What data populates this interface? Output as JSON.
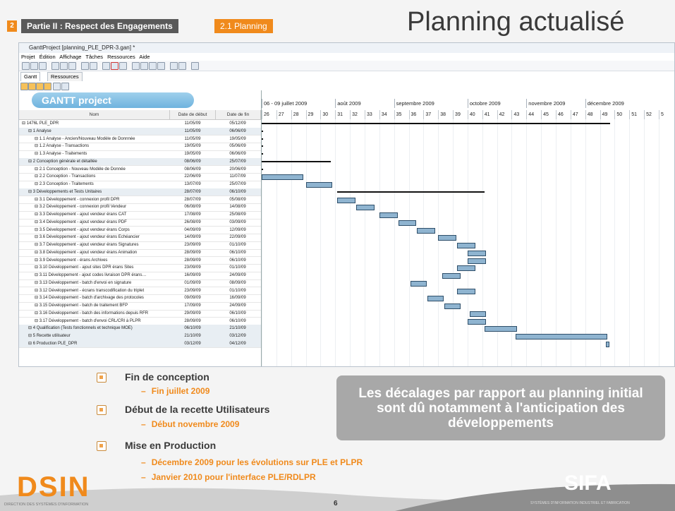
{
  "header": {
    "section_number": "2",
    "section_title": "Partie II : Respect des Engagements",
    "subsection": "2.1 Planning",
    "slide_title": "Planning actualisé"
  },
  "app": {
    "window_title": "GanttProject [planning_PLE_DPR-3.gan] *",
    "menu": [
      "Projet",
      "Édition",
      "Affichage",
      "Tâches",
      "Ressources",
      "Aide"
    ],
    "tabs": [
      "Gantt",
      "Ressources"
    ],
    "logo_text": "GANTT project",
    "columns": [
      "Nom",
      "Date de début",
      "Date de fin"
    ],
    "months": [
      "06 - 09 juillet 2009",
      "août 2009",
      "septembre 2009",
      "octobre 2009",
      "novembre 2009",
      "décembre 2009"
    ],
    "weeks": [
      "26",
      "27",
      "28",
      "29",
      "30",
      "31",
      "32",
      "33",
      "34",
      "35",
      "36",
      "37",
      "38",
      "39",
      "40",
      "41",
      "42",
      "43",
      "44",
      "45",
      "46",
      "47",
      "48",
      "49",
      "50",
      "51",
      "52",
      "5"
    ],
    "tasks": [
      {
        "name": "1476L PLE_DPR",
        "start": "11/05/09",
        "end": "05/12/09",
        "indent": 0
      },
      {
        "name": "1 Analyse",
        "start": "11/05/09",
        "end": "06/06/09",
        "indent": 1
      },
      {
        "name": "1.1 Analyse - Ancien/Nouveau Modèle de Donnnée",
        "start": "11/05/09",
        "end": "19/05/09",
        "indent": 2
      },
      {
        "name": "1.2 Analyse - Transactions",
        "start": "19/05/09",
        "end": "05/06/09",
        "indent": 2
      },
      {
        "name": "1.3 Analyse - Traitements",
        "start": "19/05/09",
        "end": "06/06/09",
        "indent": 2
      },
      {
        "name": "2 Conception générale et détaillée",
        "start": "08/06/09",
        "end": "25/07/09",
        "indent": 1
      },
      {
        "name": "2.1 Conception - Nouveau Modèle de Donnée",
        "start": "08/06/09",
        "end": "20/06/09",
        "indent": 2
      },
      {
        "name": "2.2 Conception - Transactions",
        "start": "22/06/09",
        "end": "11/07/09",
        "indent": 2
      },
      {
        "name": "2.3 Conception - Traitements",
        "start": "13/07/09",
        "end": "25/07/09",
        "indent": 2
      },
      {
        "name": "3 Développements et Tests Unitaires",
        "start": "28/07/09",
        "end": "06/10/09",
        "indent": 1
      },
      {
        "name": "3.1 Développement - connexion profil DPR",
        "start": "28/07/09",
        "end": "05/08/09",
        "indent": 2
      },
      {
        "name": "3.2 Développement - connexion profil Vendeur",
        "start": "06/08/09",
        "end": "14/08/09",
        "indent": 2
      },
      {
        "name": "3.3 Développement - ajout vendeur érans CAT",
        "start": "17/08/09",
        "end": "25/08/09",
        "indent": 2
      },
      {
        "name": "3.4 Développement - ajout vendeur érans PDF",
        "start": "26/08/09",
        "end": "03/09/09",
        "indent": 2
      },
      {
        "name": "3.5 Développement - ajout vendeur érans Corps",
        "start": "04/09/09",
        "end": "12/09/09",
        "indent": 2
      },
      {
        "name": "3.6 Développement - ajout vendeur érans Echéancier",
        "start": "14/09/09",
        "end": "22/09/09",
        "indent": 2
      },
      {
        "name": "3.7 Développement - ajout vendeur érans Signatures",
        "start": "23/09/09",
        "end": "01/10/09",
        "indent": 2
      },
      {
        "name": "3.8 Développement - ajout vendeur érans Animation",
        "start": "28/09/09",
        "end": "06/10/09",
        "indent": 2
      },
      {
        "name": "3.9 Développement - érans Archives",
        "start": "28/09/09",
        "end": "06/10/09",
        "indent": 2
      },
      {
        "name": "3.10 Développement - ajout sites DPR érans Sites",
        "start": "23/09/09",
        "end": "01/10/09",
        "indent": 2
      },
      {
        "name": "3.11 Développement - ajout codes livraison DPR érans…",
        "start": "16/09/09",
        "end": "24/09/09",
        "indent": 2
      },
      {
        "name": "3.13 Développement - batch d'envoi en signature",
        "start": "01/09/09",
        "end": "08/09/09",
        "indent": 2
      },
      {
        "name": "3.12 Développement - écrans transcodification du triplet",
        "start": "23/09/09",
        "end": "01/10/09",
        "indent": 2
      },
      {
        "name": "3.14 Développement - batch d'archivage des protocoles",
        "start": "09/09/09",
        "end": "16/09/09",
        "indent": 2
      },
      {
        "name": "3.15 Développement - batch de traitement BFP",
        "start": "17/09/09",
        "end": "24/09/09",
        "indent": 2
      },
      {
        "name": "3.16 Développement - batch des informations depuis RFR",
        "start": "29/09/09",
        "end": "06/10/09",
        "indent": 2
      },
      {
        "name": "3.17 Développement - batch d'envoi CRL/CRI à PLPR",
        "start": "28/09/09",
        "end": "06/10/09",
        "indent": 2
      },
      {
        "name": "4 Qualification (Tests fonctionnels et technique MOE)",
        "start": "06/10/09",
        "end": "21/10/09",
        "indent": 1
      },
      {
        "name": "5 Recette utilisateur",
        "start": "21/10/09",
        "end": "03/12/09",
        "indent": 1
      },
      {
        "name": "6 Production PLE_DPR",
        "start": "03/12/09",
        "end": "04/12/09",
        "indent": 1
      }
    ]
  },
  "bullets": [
    {
      "title": "Fin de conception",
      "sub": [
        "Fin juillet 2009"
      ]
    },
    {
      "title": "Début de la recette Utilisateurs",
      "sub": [
        "Début novembre 2009"
      ]
    },
    {
      "title": "Mise en Production",
      "sub": [
        "Décembre 2009 pour les évolutions sur PLE et PLPR",
        "Janvier 2010 pour l'interface PLE/RDLPR"
      ]
    }
  ],
  "callout": "Les décalages par rapport au planning initial sont dû notamment à l'anticipation des développements",
  "footer": {
    "page_number": "6",
    "left_logo": "DSIN",
    "left_logo_sub": "DIRECTION DES SYSTÈMES D'INFORMATION",
    "right_logo": "SIFA",
    "right_logo_sub": "SYSTÈMES D'INFORMATION INDUSTRIEL ET FABRICATION"
  },
  "colors": {
    "accent": "#f08a1c",
    "bar": "#8fb4d0",
    "callout": "#a8a8a8"
  }
}
